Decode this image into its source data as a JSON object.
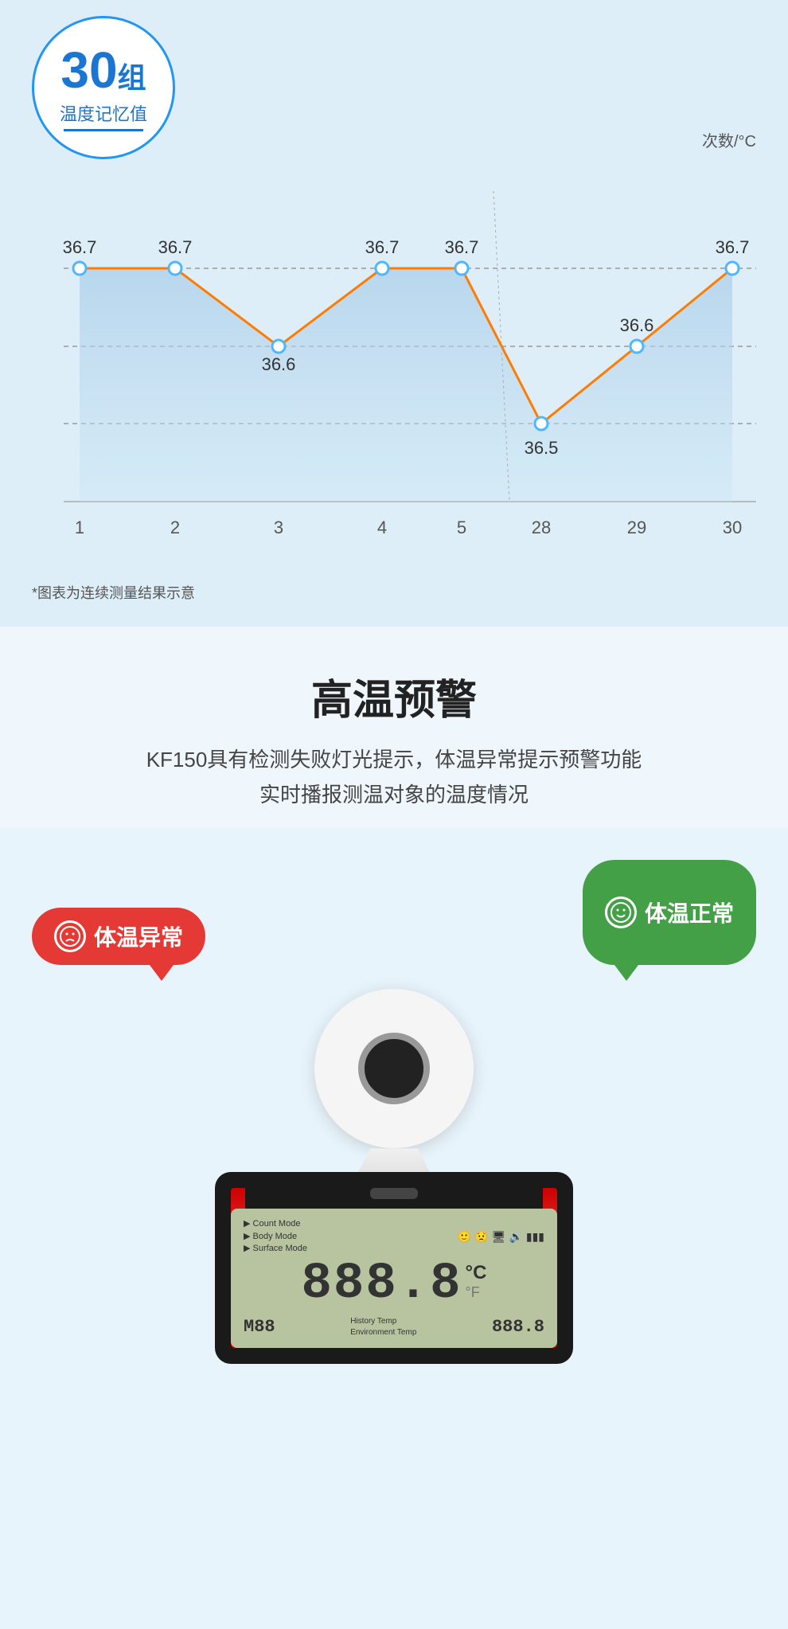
{
  "badge": {
    "number": "30",
    "unit": "组",
    "text": "温度记忆值"
  },
  "axis_label": "次数/°C",
  "chart": {
    "data_points": [
      {
        "x": 1,
        "y": 36.7
      },
      {
        "x": 2,
        "y": 36.7
      },
      {
        "x": 3,
        "y": 36.6
      },
      {
        "x": 4,
        "y": 36.7
      },
      {
        "x": 5,
        "y": 36.7
      },
      {
        "x": 28,
        "y": 36.5
      },
      {
        "x": 29,
        "y": 36.6
      },
      {
        "x": 30,
        "y": 36.7
      }
    ],
    "x_labels": [
      "1",
      "2",
      "3",
      "4",
      "5",
      "28",
      "29",
      "30"
    ],
    "y_min": 36.4,
    "y_max": 36.8,
    "grid_lines": [
      36.5,
      36.6,
      36.7
    ]
  },
  "chart_note": "*图表为连续测量结果示意",
  "section_title": "高温预警",
  "section_desc_line1": "KF150具有检测失败灯光提示，体温异常提示预警功能",
  "section_desc_line2": "实时播报测温对象的温度情况",
  "bubble_abnormal": "体温异常",
  "bubble_normal": "体温正常",
  "device": {
    "screen_mode1": "▶ Count Mode",
    "screen_mode2": "▶ Body Mode",
    "screen_mode3": "▶ Surface Mode",
    "main_digits": "888.8",
    "unit_c": "°C",
    "unit_f": "°F",
    "bottom_left_label1": "History Temp",
    "bottom_left_label2": "Environment Temp",
    "bottom_left_value": "M88",
    "bottom_right_value": "888.8"
  },
  "colors": {
    "background": "#ddeef8",
    "blue": "#1976d2",
    "orange": "#ff7c00",
    "red_bubble": "#e53935",
    "green_bubble": "#43a047",
    "chart_fill": "#b8d8f0"
  }
}
